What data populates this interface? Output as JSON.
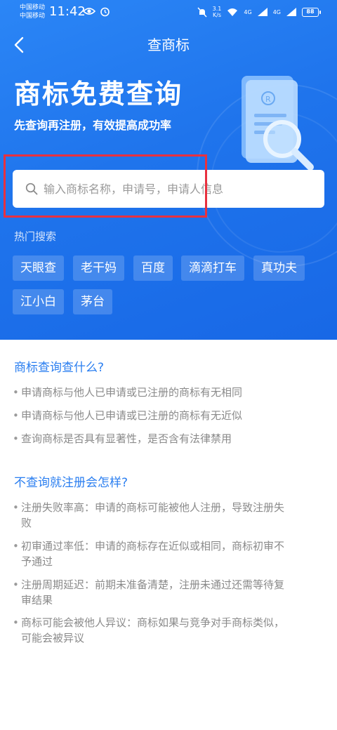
{
  "status_bar": {
    "carrier1": "中国移动",
    "carrier2": "中国移动",
    "time": "11:42",
    "speed_value": "3.1",
    "speed_unit": "K/s",
    "signal1": "4G",
    "signal2": "4G",
    "battery": "88"
  },
  "nav": {
    "title": "查商标"
  },
  "hero": {
    "title": "商标免费查询",
    "subtitle": "先查询再注册，有效提高成功率"
  },
  "search": {
    "placeholder": "输入商标名称，申请号，申请人信息"
  },
  "hot_search": {
    "label": "热门搜索",
    "tags": [
      "天眼查",
      "老干妈",
      "百度",
      "滴滴打车",
      "真功夫",
      "江小白",
      "茅台"
    ]
  },
  "sections": [
    {
      "title": "商标查询查什么?",
      "items": [
        "申请商标与他人已申请或已注册的商标有无相同",
        "申请商标与他人已申请或已注册的商标有无近似",
        "查询商标是否具有显著性，是否含有法律禁用"
      ]
    },
    {
      "title": "不查询就注册会怎样?",
      "items": [
        [
          "注册失败率高：申请的商标可能被他人注册，导致注册失",
          "败"
        ],
        [
          "初审通过率低：申请的商标存在近似或相同，商标初审不",
          "予通过"
        ],
        [
          "注册周期延迟：前期未准备清楚，注册未通过还需等待复",
          "审结果"
        ],
        [
          "商标可能会被他人异议：商标如果与竞争对手商标类似，",
          "可能会被异议"
        ]
      ]
    }
  ],
  "colors": {
    "brand_blue": "#1f74ec",
    "link_blue": "#2a7ef0",
    "highlight_red": "#e8313f"
  }
}
